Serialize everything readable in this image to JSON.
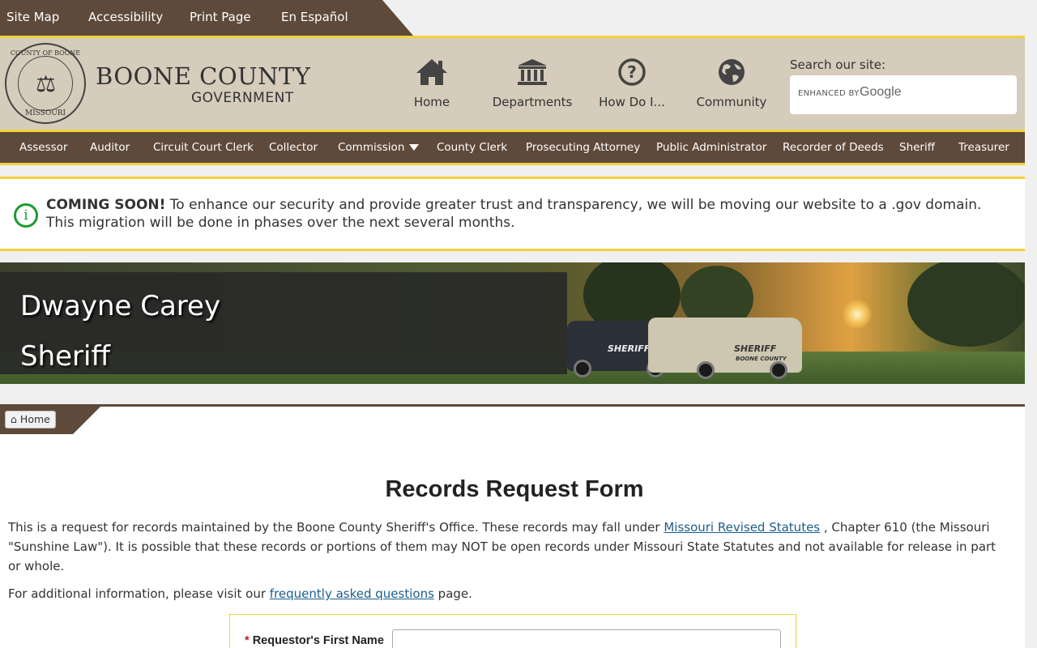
{
  "util_nav": [
    "Site Map",
    "Accessibility",
    "Print Page",
    "En Español"
  ],
  "brand": {
    "line1": "BOONE COUNTY",
    "line2": "GOVERNMENT",
    "seal_top": "COUNTY OF BOONE",
    "seal_bottom": "MISSOURI"
  },
  "main_nav": [
    {
      "label": "Home",
      "icon": "home-icon"
    },
    {
      "label": "Departments",
      "icon": "bank-icon"
    },
    {
      "label": "How Do I...",
      "icon": "question-icon"
    },
    {
      "label": "Community",
      "icon": "globe-icon"
    }
  ],
  "search": {
    "label": "Search our site:",
    "enhanced": "ENHANCED BY",
    "brand": "Google"
  },
  "dept_nav": [
    "Assessor",
    "Auditor",
    "Circuit Court Clerk",
    "Collector",
    "Commission",
    "County Clerk",
    "Prosecuting Attorney",
    "Public Administrator",
    "Recorder of Deeds",
    "Sheriff",
    "Treasurer"
  ],
  "alert": {
    "strong": "COMING SOON!",
    "text": " To enhance our security and provide greater trust and transparency, we will be moving our website to a .gov domain. This migration will be done in phases over the next several months."
  },
  "banner": {
    "name": "Dwayne Carey",
    "title": "Sheriff",
    "car_label_1": "SHERIFF",
    "car_label_2": "BOONE COUNTY"
  },
  "breadcrumb": {
    "home": "Home"
  },
  "form": {
    "title": "Records Request Form",
    "intro_1": "This is a request for records maintained by the Boone County Sheriff's Office. These records may fall under ",
    "intro_link": "Missouri Revised Statutes",
    "intro_2": " , Chapter 610 (the Missouri \"Sunshine Law\"). It is possible that these records or portions of them may NOT be open records under Missouri State Statutes and not available for release in part or whole.",
    "faq_1": "For additional information, please visit our ",
    "faq_link": "frequently asked questions",
    "faq_2": " page.",
    "first_name_label": "Requestor's First Name",
    "required_mark": "*",
    "first_name_value": ""
  },
  "colors": {
    "brown": "#5e4a3a",
    "gold": "#f0d23a",
    "tan": "#d6ccbb",
    "info_green": "#1e9a2e",
    "link": "#1a5e8a"
  }
}
